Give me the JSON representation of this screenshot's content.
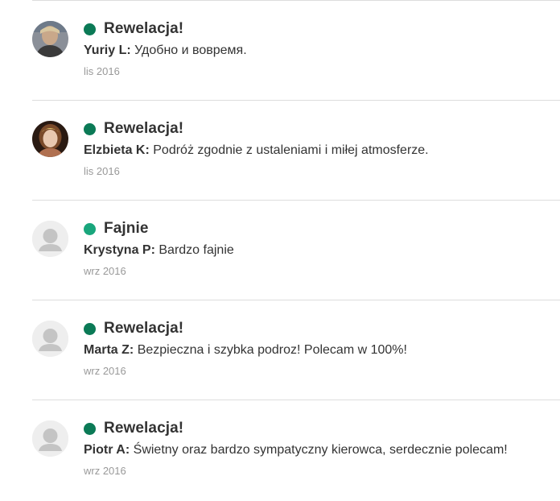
{
  "colors": {
    "rating_excellent": "#0b7a56",
    "rating_good": "#19a67c",
    "divider": "#dddddd",
    "date_text": "#999999"
  },
  "reviews": [
    {
      "avatar": "user-photo",
      "rating_label": "Rewelacja!",
      "rating_color": "#0b7a56",
      "author": "Yuriy L:",
      "text": "Удобно и вовремя.",
      "date": "lis 2016"
    },
    {
      "avatar": "user-photo",
      "rating_label": "Rewelacja!",
      "rating_color": "#0b7a56",
      "author": "Elzbieta K:",
      "text": "Podróż zgodnie z ustaleniami i miłej atmosferze.",
      "date": "lis 2016"
    },
    {
      "avatar": "default-user-icon",
      "rating_label": "Fajnie",
      "rating_color": "#19a67c",
      "author": "Krystyna P:",
      "text": "Bardzo fajnie",
      "date": "wrz 2016"
    },
    {
      "avatar": "default-user-icon",
      "rating_label": "Rewelacja!",
      "rating_color": "#0b7a56",
      "author": "Marta Z:",
      "text": "Bezpieczna i szybka podroz! Polecam w 100%!",
      "date": "wrz 2016"
    },
    {
      "avatar": "default-user-icon",
      "rating_label": "Rewelacja!",
      "rating_color": "#0b7a56",
      "author": "Piotr A:",
      "text": "Świetny oraz bardzo sympatyczny kierowca, serdecznie polecam!",
      "date": "wrz 2016"
    }
  ]
}
